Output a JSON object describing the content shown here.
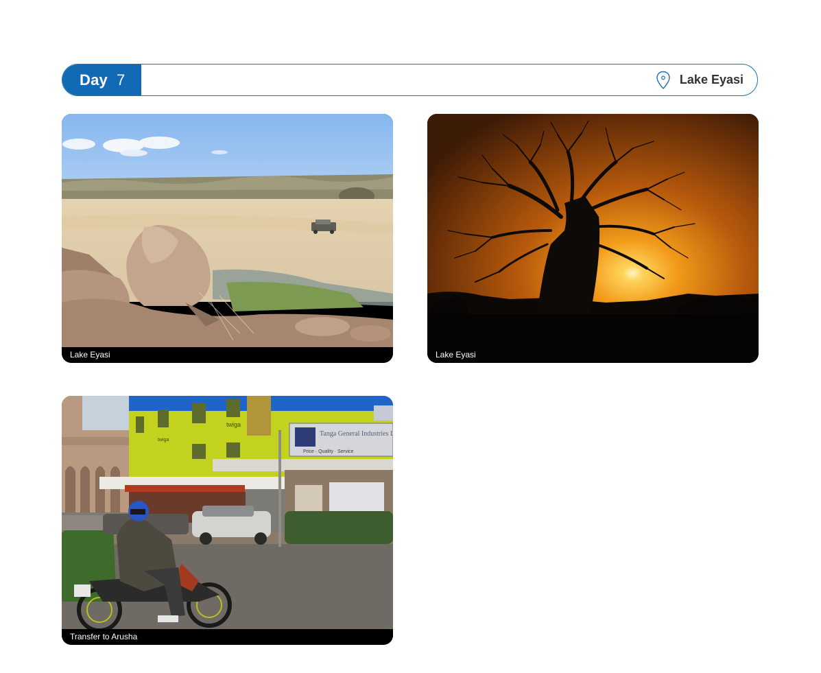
{
  "day": {
    "label": "Day",
    "number": "7",
    "location": "Lake Eyasi",
    "accent_color": "#136ab4"
  },
  "photos": [
    {
      "caption": "Lake Eyasi",
      "scene": "dry lakebed with boulders and a safari vehicle"
    },
    {
      "caption": "Lake Eyasi",
      "scene": "baobab tree silhouette at sunset"
    },
    {
      "caption": "Transfer to Arusha",
      "scene": "town street with motorcyclist and yellow-green building"
    }
  ],
  "photo_texts": {
    "sign_brand": "twiga",
    "sign_company": "Tanga General Industries Ltd",
    "sign_motto": "Price · Quality · Service"
  }
}
